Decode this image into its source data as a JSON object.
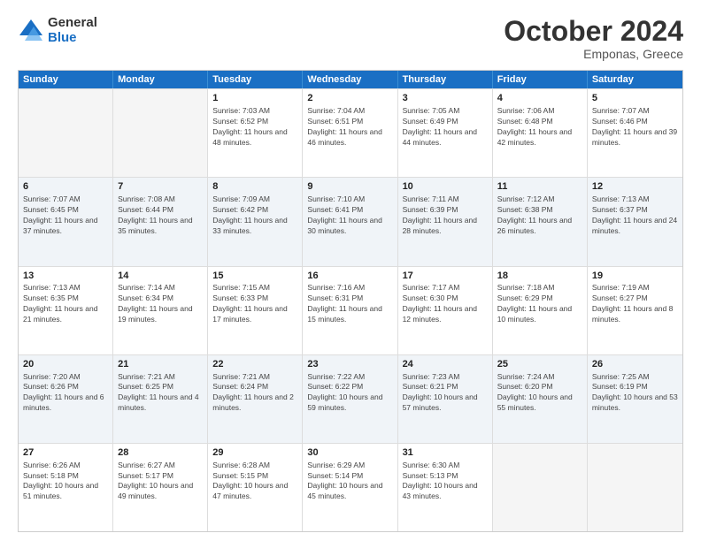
{
  "logo": {
    "general": "General",
    "blue": "Blue"
  },
  "title": "October 2024",
  "location": "Emponas, Greece",
  "days": [
    "Sunday",
    "Monday",
    "Tuesday",
    "Wednesday",
    "Thursday",
    "Friday",
    "Saturday"
  ],
  "rows": [
    [
      {
        "day": "",
        "info": ""
      },
      {
        "day": "",
        "info": ""
      },
      {
        "day": "1",
        "info": "Sunrise: 7:03 AM\nSunset: 6:52 PM\nDaylight: 11 hours and 48 minutes."
      },
      {
        "day": "2",
        "info": "Sunrise: 7:04 AM\nSunset: 6:51 PM\nDaylight: 11 hours and 46 minutes."
      },
      {
        "day": "3",
        "info": "Sunrise: 7:05 AM\nSunset: 6:49 PM\nDaylight: 11 hours and 44 minutes."
      },
      {
        "day": "4",
        "info": "Sunrise: 7:06 AM\nSunset: 6:48 PM\nDaylight: 11 hours and 42 minutes."
      },
      {
        "day": "5",
        "info": "Sunrise: 7:07 AM\nSunset: 6:46 PM\nDaylight: 11 hours and 39 minutes."
      }
    ],
    [
      {
        "day": "6",
        "info": "Sunrise: 7:07 AM\nSunset: 6:45 PM\nDaylight: 11 hours and 37 minutes."
      },
      {
        "day": "7",
        "info": "Sunrise: 7:08 AM\nSunset: 6:44 PM\nDaylight: 11 hours and 35 minutes."
      },
      {
        "day": "8",
        "info": "Sunrise: 7:09 AM\nSunset: 6:42 PM\nDaylight: 11 hours and 33 minutes."
      },
      {
        "day": "9",
        "info": "Sunrise: 7:10 AM\nSunset: 6:41 PM\nDaylight: 11 hours and 30 minutes."
      },
      {
        "day": "10",
        "info": "Sunrise: 7:11 AM\nSunset: 6:39 PM\nDaylight: 11 hours and 28 minutes."
      },
      {
        "day": "11",
        "info": "Sunrise: 7:12 AM\nSunset: 6:38 PM\nDaylight: 11 hours and 26 minutes."
      },
      {
        "day": "12",
        "info": "Sunrise: 7:13 AM\nSunset: 6:37 PM\nDaylight: 11 hours and 24 minutes."
      }
    ],
    [
      {
        "day": "13",
        "info": "Sunrise: 7:13 AM\nSunset: 6:35 PM\nDaylight: 11 hours and 21 minutes."
      },
      {
        "day": "14",
        "info": "Sunrise: 7:14 AM\nSunset: 6:34 PM\nDaylight: 11 hours and 19 minutes."
      },
      {
        "day": "15",
        "info": "Sunrise: 7:15 AM\nSunset: 6:33 PM\nDaylight: 11 hours and 17 minutes."
      },
      {
        "day": "16",
        "info": "Sunrise: 7:16 AM\nSunset: 6:31 PM\nDaylight: 11 hours and 15 minutes."
      },
      {
        "day": "17",
        "info": "Sunrise: 7:17 AM\nSunset: 6:30 PM\nDaylight: 11 hours and 12 minutes."
      },
      {
        "day": "18",
        "info": "Sunrise: 7:18 AM\nSunset: 6:29 PM\nDaylight: 11 hours and 10 minutes."
      },
      {
        "day": "19",
        "info": "Sunrise: 7:19 AM\nSunset: 6:27 PM\nDaylight: 11 hours and 8 minutes."
      }
    ],
    [
      {
        "day": "20",
        "info": "Sunrise: 7:20 AM\nSunset: 6:26 PM\nDaylight: 11 hours and 6 minutes."
      },
      {
        "day": "21",
        "info": "Sunrise: 7:21 AM\nSunset: 6:25 PM\nDaylight: 11 hours and 4 minutes."
      },
      {
        "day": "22",
        "info": "Sunrise: 7:21 AM\nSunset: 6:24 PM\nDaylight: 11 hours and 2 minutes."
      },
      {
        "day": "23",
        "info": "Sunrise: 7:22 AM\nSunset: 6:22 PM\nDaylight: 10 hours and 59 minutes."
      },
      {
        "day": "24",
        "info": "Sunrise: 7:23 AM\nSunset: 6:21 PM\nDaylight: 10 hours and 57 minutes."
      },
      {
        "day": "25",
        "info": "Sunrise: 7:24 AM\nSunset: 6:20 PM\nDaylight: 10 hours and 55 minutes."
      },
      {
        "day": "26",
        "info": "Sunrise: 7:25 AM\nSunset: 6:19 PM\nDaylight: 10 hours and 53 minutes."
      }
    ],
    [
      {
        "day": "27",
        "info": "Sunrise: 6:26 AM\nSunset: 5:18 PM\nDaylight: 10 hours and 51 minutes."
      },
      {
        "day": "28",
        "info": "Sunrise: 6:27 AM\nSunset: 5:17 PM\nDaylight: 10 hours and 49 minutes."
      },
      {
        "day": "29",
        "info": "Sunrise: 6:28 AM\nSunset: 5:15 PM\nDaylight: 10 hours and 47 minutes."
      },
      {
        "day": "30",
        "info": "Sunrise: 6:29 AM\nSunset: 5:14 PM\nDaylight: 10 hours and 45 minutes."
      },
      {
        "day": "31",
        "info": "Sunrise: 6:30 AM\nSunset: 5:13 PM\nDaylight: 10 hours and 43 minutes."
      },
      {
        "day": "",
        "info": ""
      },
      {
        "day": "",
        "info": ""
      }
    ]
  ]
}
